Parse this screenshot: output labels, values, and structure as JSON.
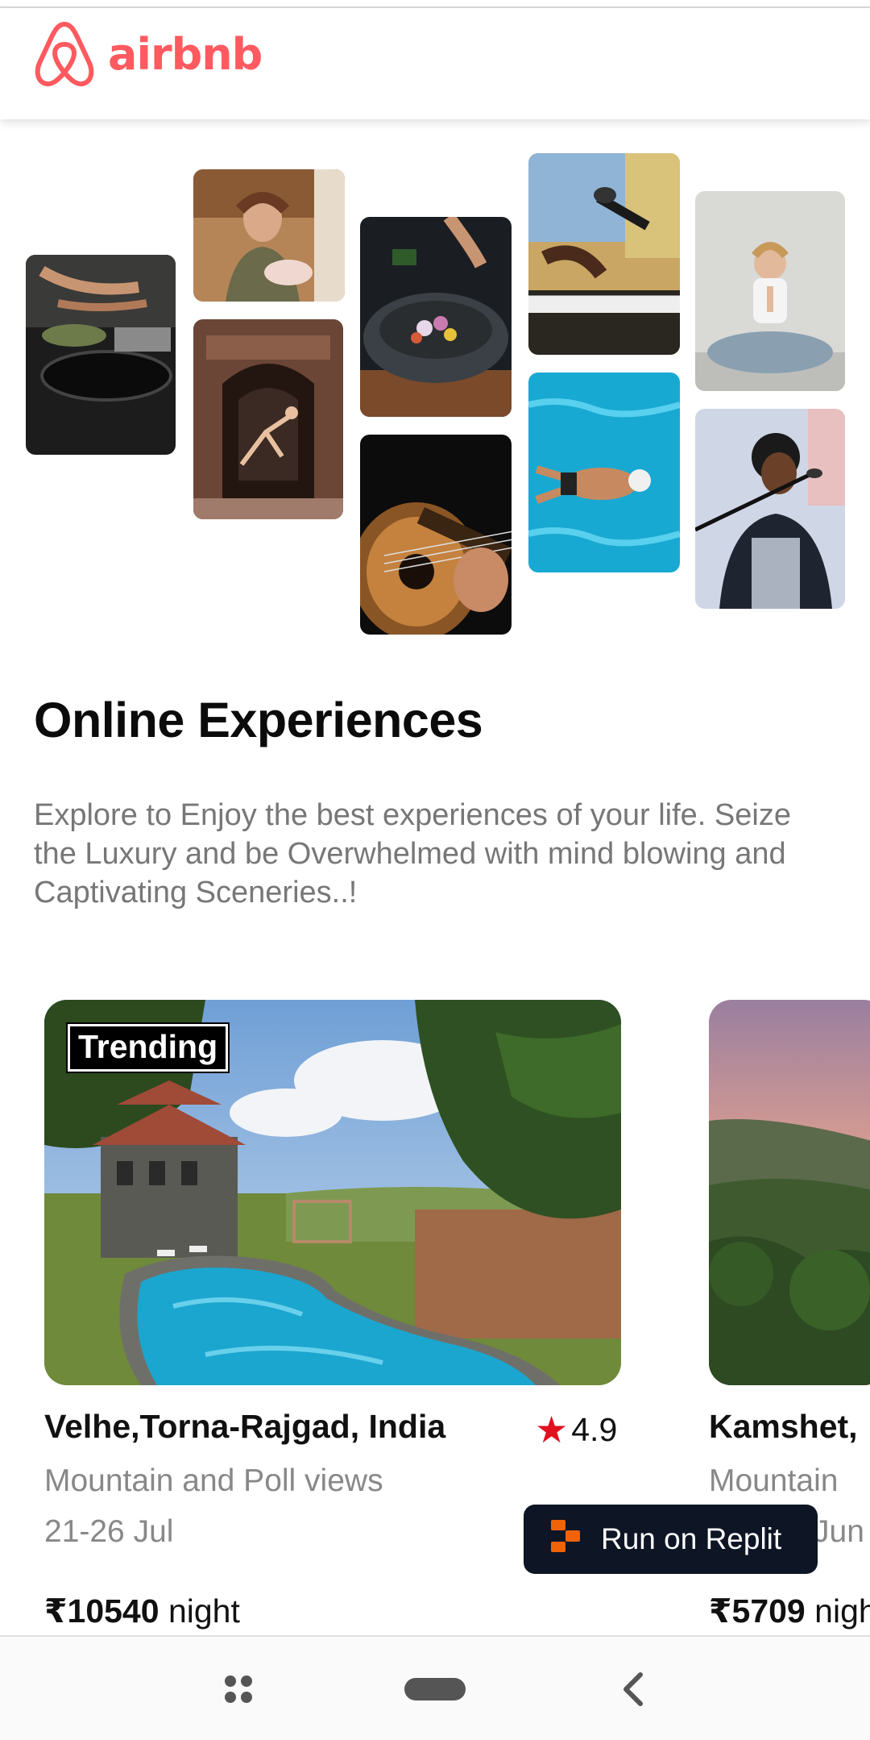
{
  "header": {
    "brand": "airbnb",
    "brand_color": "#ff5a5f"
  },
  "gallery": {
    "tiles": [
      {
        "icon": "cooking-photo"
      },
      {
        "icon": "chef-photo"
      },
      {
        "icon": "dancer-photo"
      },
      {
        "icon": "food-bowl-photo"
      },
      {
        "icon": "guitar-photo"
      },
      {
        "icon": "keyboard-mic-photo"
      },
      {
        "icon": "swimmer-photo"
      },
      {
        "icon": "yoga-photo"
      },
      {
        "icon": "singer-photo"
      }
    ]
  },
  "main": {
    "title": "Online Experiences",
    "description": "Explore to Enjoy the best experiences of your life. Seize the Luxury and be Overwhelmed with mind blowing and Captivating Sceneries..!"
  },
  "listings": [
    {
      "badge": "Trending",
      "location": "Velhe,Torna-Rajgad, India",
      "rating": "4.9",
      "subtitle": "Mountain and Poll views",
      "dates": "21-26 Jul",
      "price": "₹10540",
      "price_unit": "night"
    },
    {
      "location": "Kamshet,",
      "subtitle": "Mountain",
      "dates": "Jun",
      "price": "₹5709",
      "price_unit": "nigh"
    }
  ],
  "replit": {
    "label": "Run on Replit"
  },
  "nav": {
    "icons": [
      "recent-apps-icon",
      "home-pill-icon",
      "back-icon"
    ]
  }
}
